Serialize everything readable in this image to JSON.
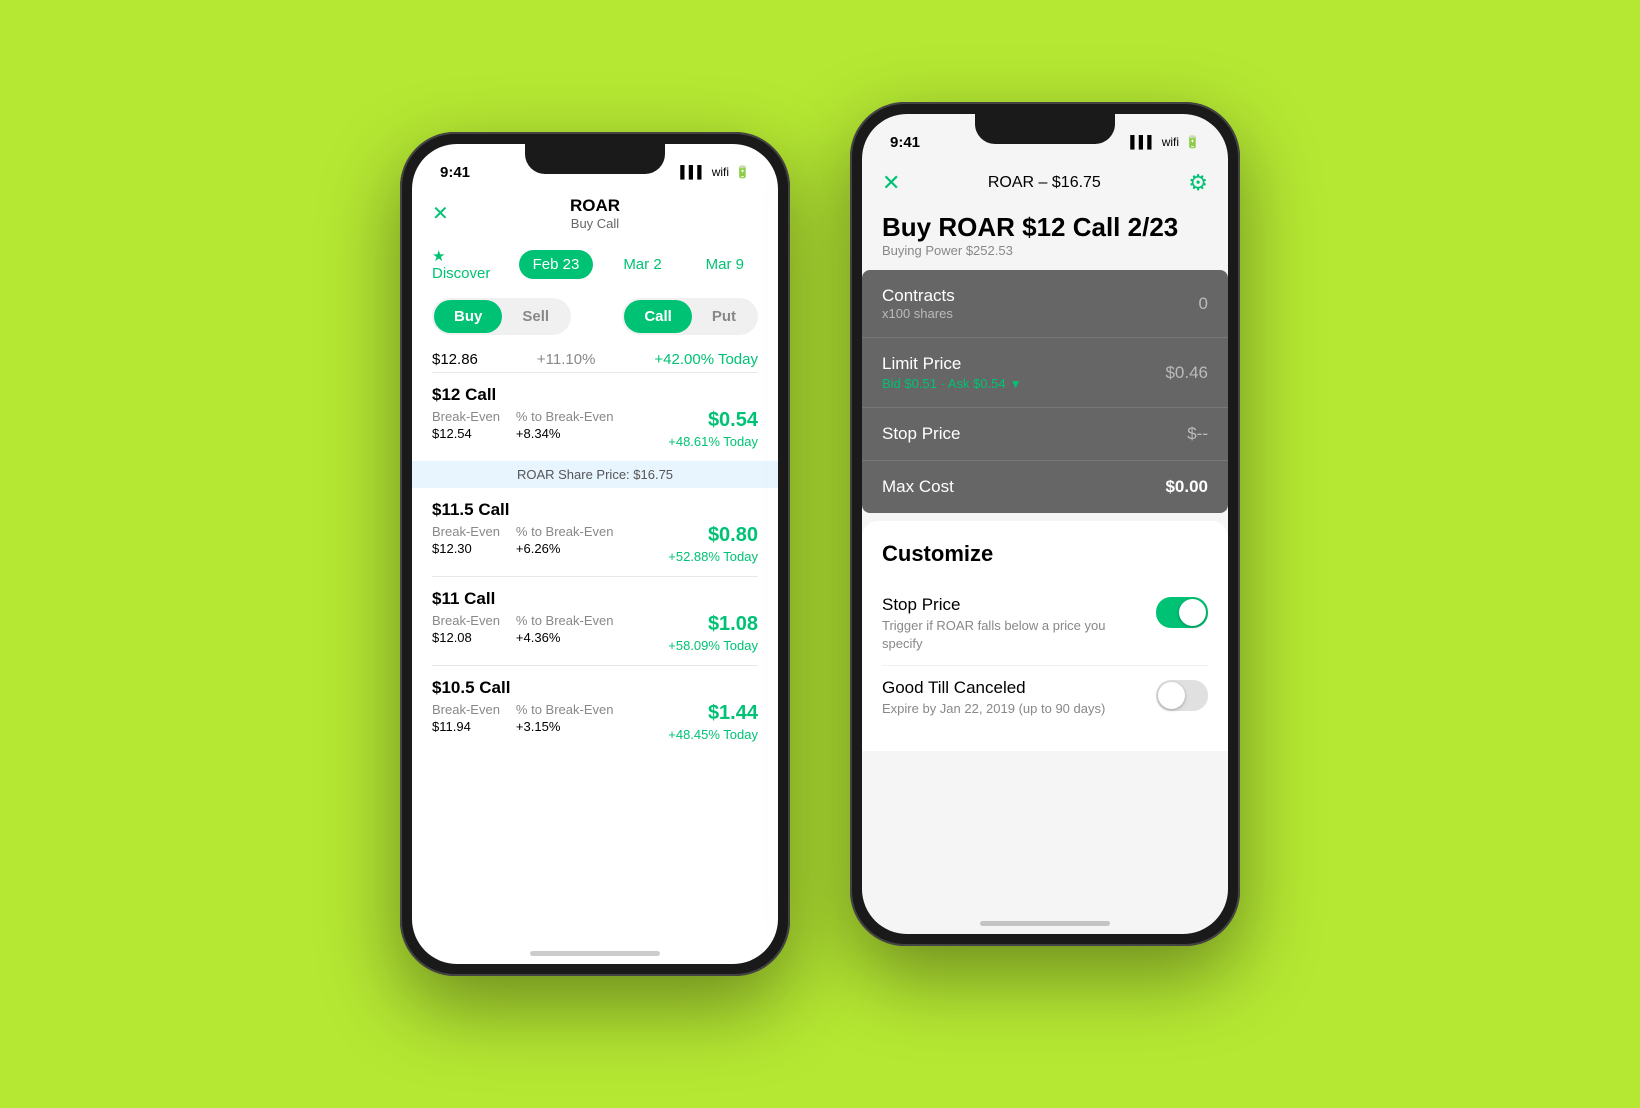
{
  "background_color": "#b5e833",
  "phone1": {
    "status_time": "9:41",
    "nav_close": "✕",
    "nav_title": "ROAR",
    "nav_subtitle": "Buy Call",
    "discover_label": "★ Discover",
    "tabs": [
      {
        "label": "Feb 23",
        "active": true
      },
      {
        "label": "Mar 2",
        "active": false
      },
      {
        "label": "Mar 9",
        "active": false
      }
    ],
    "buy_label": "Buy",
    "sell_label": "Sell",
    "call_label": "Call",
    "put_label": "Put",
    "price_main": "$12.86",
    "price_change": "+11.10%",
    "price_today": "+42.00% Today",
    "share_price_banner": "ROAR Share Price: $16.75",
    "options": [
      {
        "title": "$12 Call",
        "break_even_label": "Break-Even",
        "break_even_val": "$12.54",
        "pct_label": "% to Break-Even",
        "pct_val": "+8.34%",
        "price": "$0.54",
        "today": "+48.61% Today"
      },
      {
        "title": "$11.5 Call",
        "break_even_label": "Break-Even",
        "break_even_val": "$12.30",
        "pct_label": "% to Break-Even",
        "pct_val": "+6.26%",
        "price": "$0.80",
        "today": "+52.88% Today"
      },
      {
        "title": "$11 Call",
        "break_even_label": "Break-Even",
        "break_even_val": "$12.08",
        "pct_label": "% to Break-Even",
        "pct_val": "+4.36%",
        "price": "$1.08",
        "today": "+58.09% Today"
      },
      {
        "title": "$10.5 Call",
        "break_even_label": "Break-Even",
        "break_even_val": "$11.94",
        "pct_label": "% to Break-Even",
        "pct_val": "+3.15%",
        "price": "$1.44",
        "today": "+48.45% Today"
      }
    ]
  },
  "phone2": {
    "status_time": "9:41",
    "header_title": "ROAR – $16.75",
    "order_title": "Buy ROAR $12 Call 2/23",
    "buying_power": "Buying Power $252.53",
    "fields": {
      "contracts_label": "Contracts",
      "contracts_sub": "x100 shares",
      "contracts_value": "0",
      "limit_price_label": "Limit Price",
      "bid_ask": "Bid $0.51 · Ask $0.54",
      "limit_value": "$0.46",
      "stop_price_label": "Stop Price",
      "stop_value": "$--",
      "max_cost_label": "Max Cost",
      "max_cost_value": "$0.00"
    },
    "customize": {
      "title": "Customize",
      "items": [
        {
          "label": "Stop Price",
          "sub": "Trigger if ROAR falls below a price you specify",
          "toggle": true
        },
        {
          "label": "Good Till Canceled",
          "sub": "Expire by Jan 22, 2019 (up to 90 days)",
          "toggle": false
        }
      ]
    }
  }
}
